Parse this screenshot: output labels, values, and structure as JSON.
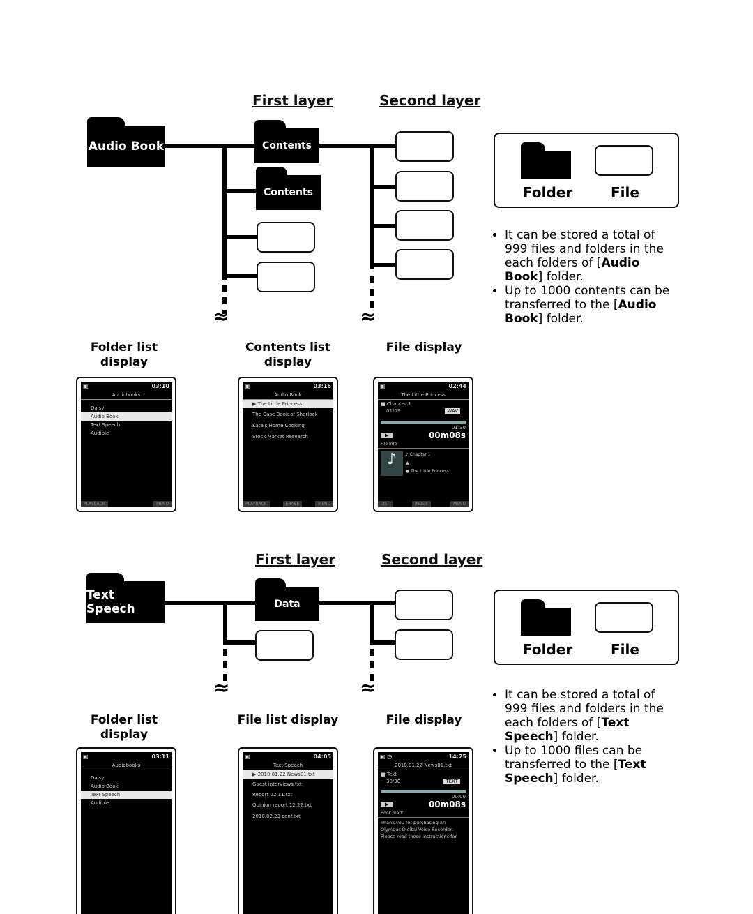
{
  "audio_book": {
    "layers": {
      "first": "First layer",
      "second": "Second layer"
    },
    "root_folder": "Audio Book",
    "subfolders": [
      "Contents",
      "Contents"
    ],
    "legend": {
      "folder": "Folder",
      "file": "File"
    },
    "notes": [
      {
        "pre": "It can be stored a total of 999 files and folders in the each folders of [",
        "bold": "Audio Book",
        "post": "] folder."
      },
      {
        "pre": "Up to 1000 contents can be transferred to the [",
        "bold": "Audio Book",
        "post": "] folder."
      }
    ],
    "captions": [
      "Folder list display",
      "Contents list display",
      "File display"
    ],
    "screens": {
      "folder_list": {
        "time": "03:10",
        "title": "Audiobooks",
        "items": [
          "Daisy",
          "Audio Book",
          "Text Speech",
          "Audible"
        ],
        "selected": 1,
        "buttons": [
          "PLAYBACK",
          "MENU"
        ]
      },
      "contents_list": {
        "time": "03:16",
        "title": "Audio Book",
        "items": [
          "The Little Princess",
          "The Case Book of Sherlock",
          "Kate's Home Cooking",
          "Stock Market Research"
        ],
        "selected": 0,
        "buttons": [
          "PLAYBACK",
          "ERASE",
          "MENU"
        ]
      },
      "file_display": {
        "time": "02:44",
        "title": "The Little Princess",
        "chapter": "Chapter 1",
        "track": "01/09",
        "format": "WAV",
        "total": "01:30",
        "elapsed": "00m08s",
        "info_label": "File Info",
        "info": [
          "Chapter 1",
          "",
          "The Little Princess"
        ],
        "buttons": [
          "LIST",
          "INDEX",
          "MENU"
        ]
      }
    }
  },
  "text_speech": {
    "layers": {
      "first": "First layer",
      "second": "Second layer"
    },
    "root_folder": "Text Speech",
    "subfolders": [
      "Data"
    ],
    "legend": {
      "folder": "Folder",
      "file": "File"
    },
    "notes": [
      {
        "pre": "It can be stored a total of 999 files and folders in the each folders of [",
        "bold": "Text Speech",
        "post": "] folder."
      },
      {
        "pre": "Up to 1000 files can be transferred to the [",
        "bold": "Text Speech",
        "post": "] folder."
      }
    ],
    "captions": [
      "Folder list display",
      "File list display",
      "File display"
    ],
    "screens": {
      "folder_list": {
        "time": "03:11",
        "title": "Audiobooks",
        "items": [
          "Daisy",
          "Audio Book",
          "Text Speech",
          "Audible"
        ],
        "selected": 2
      },
      "file_list": {
        "time": "04:05",
        "title": "Text Speech",
        "items": [
          "2010.01.22 News01.txt",
          "Guest interviews.txt",
          "Report 02.11.txt",
          "Opinion report 12.22.txt",
          "2010.02.23 conf.txt"
        ],
        "selected": 0
      },
      "file_display": {
        "time": "14:25",
        "title": "2010.01.22 News01.txt",
        "folder": "Text",
        "track": "30/30",
        "format": "TEXT",
        "total": "00:00",
        "elapsed": "00m08s",
        "info_label": "Book mark",
        "text": "Thank you for purchasing an Olympus Digital Voice Recorder. Please read these instructions for"
      }
    }
  }
}
